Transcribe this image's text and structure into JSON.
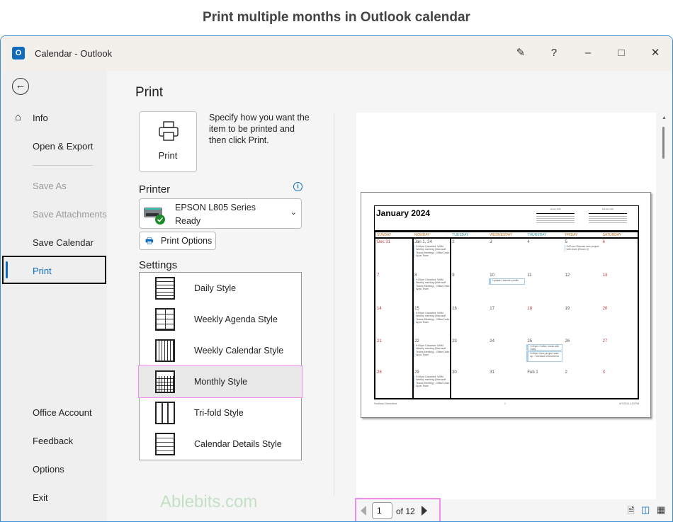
{
  "caption": "Print multiple months in Outlook calendar",
  "window": {
    "title": "Calendar  -  Outlook",
    "buttons": [
      "feedback",
      "help",
      "minimize",
      "maximize",
      "close"
    ]
  },
  "sidebar": {
    "items": [
      {
        "label": "Info",
        "icon": "home-icon",
        "disabled": false
      },
      {
        "label": "Open & Export",
        "disabled": false
      },
      {
        "label": "Save As",
        "disabled": true
      },
      {
        "label": "Save Attachments",
        "disabled": true
      },
      {
        "label": "Save Calendar",
        "disabled": false
      },
      {
        "label": "Print",
        "disabled": false,
        "selected": true
      },
      {
        "label": "Office Account",
        "disabled": false
      },
      {
        "label": "Feedback",
        "disabled": false
      },
      {
        "label": "Options",
        "disabled": false
      },
      {
        "label": "Exit",
        "disabled": false
      }
    ]
  },
  "print": {
    "title": "Print",
    "button": "Print",
    "description": "Specify how you want the item to be printed and then click Print.",
    "printer_heading": "Printer",
    "printer_name": "EPSON L805 Series",
    "printer_status": "Ready",
    "options_button": "Print Options",
    "settings_heading": "Settings",
    "styles": [
      "Daily Style",
      "Weekly Agenda Style",
      "Weekly Calendar Style",
      "Monthly Style",
      "Tri-fold Style",
      "Calendar Details Style"
    ],
    "selected_style": "Monthly Style"
  },
  "preview": {
    "month_title": "January 2024",
    "mini_cal": [
      "January 2024",
      "February 2024"
    ],
    "day_headers": [
      "SUNDAY",
      "MONDAY",
      "TUESDAY",
      "WEDNESDAY",
      "THURSDAY",
      "FRIDAY",
      "SATURDAY"
    ],
    "weeks": [
      [
        "Dec 31",
        "Jan 1, 24",
        "2",
        "3",
        "4",
        "5",
        "6"
      ],
      [
        "7",
        "8",
        "9",
        "10",
        "11",
        "12",
        "13"
      ],
      [
        "14",
        "15",
        "16",
        "17",
        "18",
        "19",
        "20"
      ],
      [
        "21",
        "22",
        "23",
        "24",
        "25",
        "26",
        "27"
      ],
      [
        "28",
        "29",
        "30",
        "31",
        "Feb 1",
        "2",
        "3"
      ]
    ],
    "events": [
      {
        "week": 0,
        "day": 1,
        "text": "9:00pm Canceled: WAM Weekly meeting (Microsoft Teams Meeting) - Office Data Apps Team"
      },
      {
        "week": 0,
        "day": 5,
        "text": "9:00 am Discuss new project with team (Room 3)"
      },
      {
        "week": 1,
        "day": 1,
        "text": "9:00pm Canceled: WAM Weekly meeting (Microsoft Teams Meeting) - Office Data Apps Team"
      },
      {
        "week": 1,
        "day": 3,
        "text": "Update LinkedIn profile",
        "boxed": true
      },
      {
        "week": 2,
        "day": 1,
        "text": "9:00pm Canceled: WAM Weekly meeting (Microsoft Teams Meeting) - Office Data Apps Team"
      },
      {
        "week": 3,
        "day": 1,
        "text": "9:00pm Canceled: WAM Weekly meeting (Microsoft Teams Meeting) - Office Data Apps Team"
      },
      {
        "week": 3,
        "day": 4,
        "text": "3:00pm Coffee break with Sally",
        "boxed": true
      },
      {
        "week": 3,
        "day": 4,
        "text": "5:00pm New project start-up - Svetlana Cheusheva",
        "boxed": true
      },
      {
        "week": 4,
        "day": 1,
        "text": "9:00pm Canceled: WAM Weekly meeting (Microsoft Teams Meeting) - Office Data Apps Team"
      }
    ],
    "footer_left": "Svetlana Cheusheva",
    "footer_center": "1",
    "footer_right": "6/7/2024 4:03 PM"
  },
  "pager": {
    "current": "1",
    "of_label": "of 12"
  },
  "watermark": "Ablebits.com",
  "colors": {
    "accent": "#0f6cbd",
    "highlight": "#f08cf0",
    "event": "#a7cdf0"
  }
}
